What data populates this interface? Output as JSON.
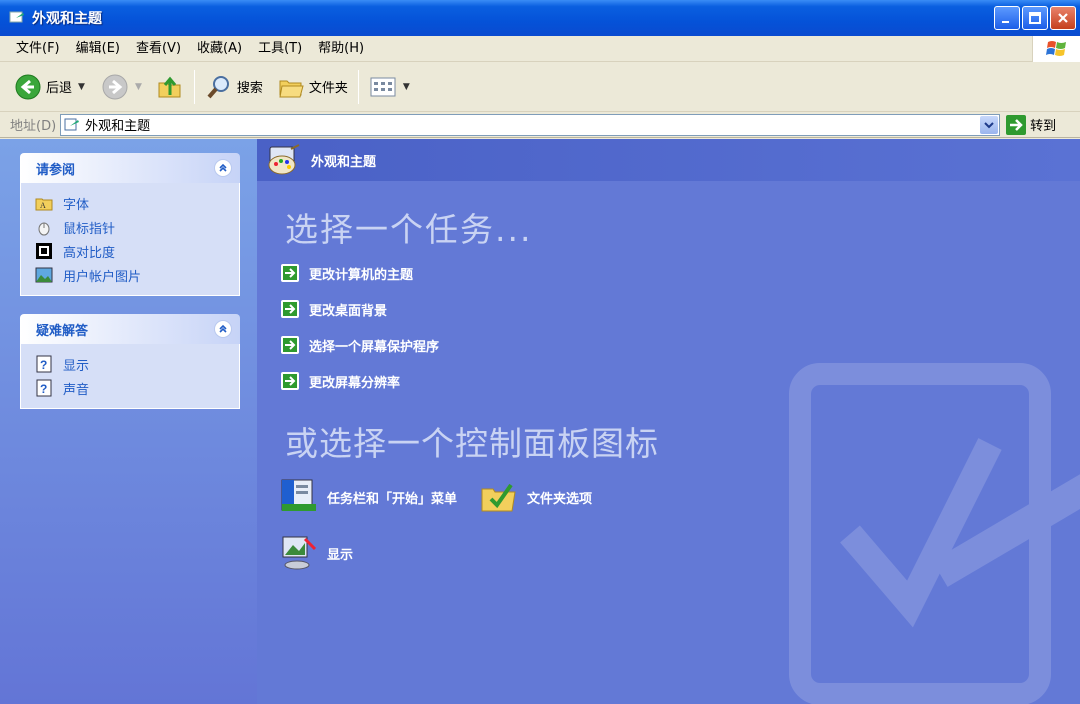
{
  "window": {
    "title": "外观和主题"
  },
  "menubar": {
    "items": [
      "文件(F)",
      "编辑(E)",
      "查看(V)",
      "收藏(A)",
      "工具(T)",
      "帮助(H)"
    ]
  },
  "toolbar": {
    "back_label": "后退",
    "search_label": "搜索",
    "folders_label": "文件夹"
  },
  "address": {
    "label": "地址(D)",
    "value": "外观和主题",
    "go_label": "转到"
  },
  "sidebar": {
    "see_also": {
      "title": "请参阅",
      "items": [
        {
          "label": "字体",
          "icon": "font-folder-icon"
        },
        {
          "label": "鼠标指针",
          "icon": "mouse-icon"
        },
        {
          "label": "高对比度",
          "icon": "contrast-icon"
        },
        {
          "label": "用户帐户图片",
          "icon": "picture-icon"
        }
      ]
    },
    "troubleshoot": {
      "title": "疑难解答",
      "items": [
        {
          "label": "显示",
          "icon": "help-icon"
        },
        {
          "label": "声音",
          "icon": "help-icon"
        }
      ]
    }
  },
  "main": {
    "header": "外观和主题",
    "task_title": "选择一个任务...",
    "tasks": [
      "更改计算机的主题",
      "更改桌面背景",
      "选择一个屏幕保护程序",
      "更改屏幕分辨率"
    ],
    "cp_title": "或选择一个控制面板图标",
    "cp_icons": [
      {
        "label": "任务栏和「开始」菜单",
        "icon": "taskbar-icon"
      },
      {
        "label": "文件夹选项",
        "icon": "folder-options-icon"
      },
      {
        "label": "显示",
        "icon": "display-icon"
      }
    ]
  },
  "colors": {
    "title_blue": "#0552d8",
    "panel_link": "#215dc6",
    "main_bg": "#6379d6"
  }
}
